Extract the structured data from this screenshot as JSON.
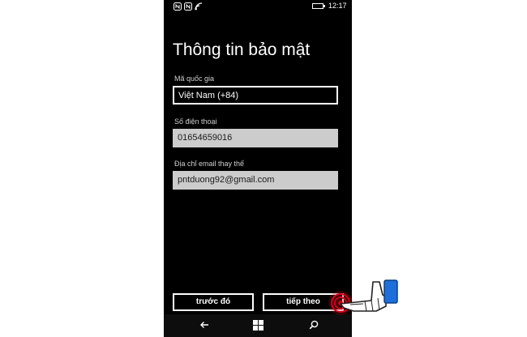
{
  "status": {
    "time": "12:17",
    "icons": [
      "nfc-icon",
      "nfc-icon",
      "wifi-icon",
      "battery-icon"
    ]
  },
  "page": {
    "title": "Thông tin bảo mật"
  },
  "form": {
    "country_label": "Mã quốc gia",
    "country_value": "Việt Nam (+84)",
    "phone_label": "Số điện thoại",
    "phone_value": "01654659016",
    "email_label": "Địa chỉ email thay thế",
    "email_value": "pntduong92@gmail.com"
  },
  "buttons": {
    "back_label": "trước đó",
    "next_label": "tiếp theo"
  },
  "nav": {
    "icons": [
      "back-arrow-icon",
      "windows-logo-icon",
      "search-icon"
    ]
  },
  "colors": {
    "screen_bg": "#000000",
    "text": "#ffffff",
    "field_light_bg": "#cccccc",
    "tap_indicator": "#d6001c",
    "hand_cuff": "#1e6fd9"
  }
}
